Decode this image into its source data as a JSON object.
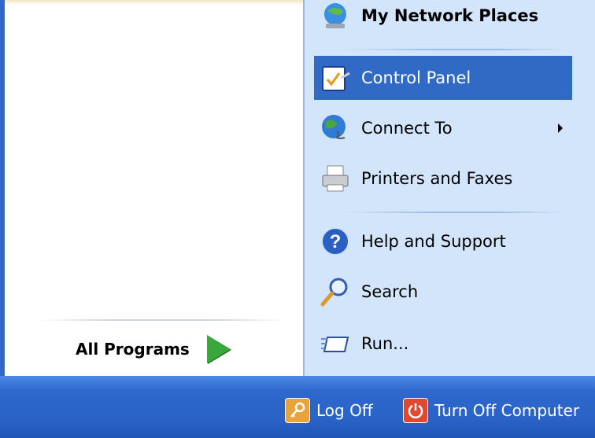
{
  "left": {
    "all_programs": "All Programs"
  },
  "right": {
    "items": [
      {
        "label": "My Network Places",
        "icon": "network-places-icon"
      },
      {
        "label": "Control Panel",
        "icon": "control-panel-icon",
        "highlighted": true
      },
      {
        "label": "Connect To",
        "icon": "connect-to-icon",
        "submenu": true
      },
      {
        "label": "Printers and Faxes",
        "icon": "printer-icon"
      },
      {
        "label": "Help and Support",
        "icon": "help-icon"
      },
      {
        "label": "Search",
        "icon": "search-icon"
      },
      {
        "label": "Run...",
        "icon": "run-icon"
      }
    ]
  },
  "bottom": {
    "log_off": "Log Off",
    "turn_off": "Turn Off Computer"
  },
  "colors": {
    "highlight": "#316ac5",
    "right_panel": "#d3e5fa",
    "bottom_bar": "#2e68cc",
    "all_programs_arrow": "#38a83a",
    "log_off_icon": "#e8a33a",
    "turn_off_icon": "#e0482f"
  }
}
